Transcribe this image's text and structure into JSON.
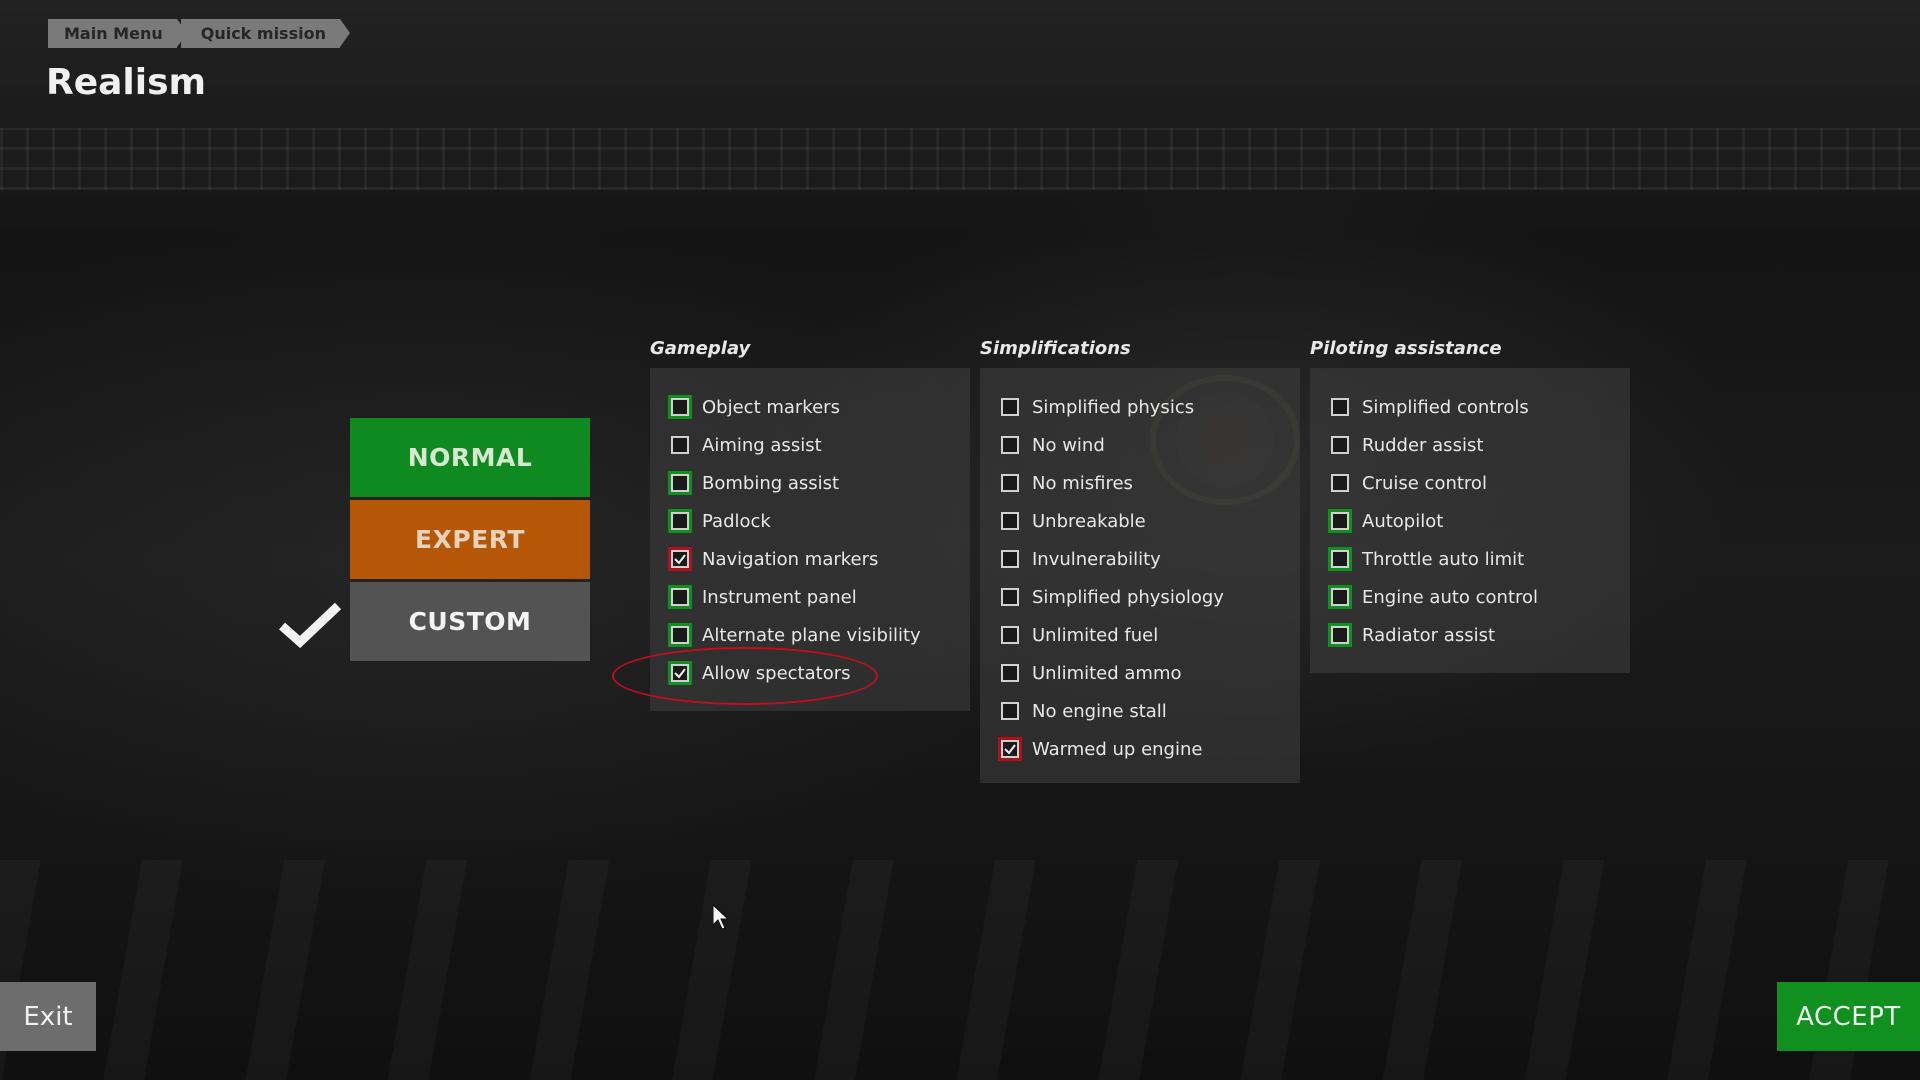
{
  "breadcrumb": [
    "Main Menu",
    "Quick mission"
  ],
  "title": "Realism",
  "presets": [
    {
      "label": "NORMAL",
      "color": "#0e8a20",
      "selected": false
    },
    {
      "label": "EXPERT",
      "color": "#b55706",
      "selected": false
    },
    {
      "label": "CUSTOM",
      "color": "#535353",
      "selected": true
    }
  ],
  "columns": [
    {
      "title": "Gameplay",
      "options": [
        {
          "label": "Object markers",
          "checked": false,
          "highlight": "green"
        },
        {
          "label": "Aiming assist",
          "checked": false,
          "highlight": "none"
        },
        {
          "label": "Bombing assist",
          "checked": false,
          "highlight": "green"
        },
        {
          "label": "Padlock",
          "checked": false,
          "highlight": "green"
        },
        {
          "label": "Navigation markers",
          "checked": true,
          "highlight": "red"
        },
        {
          "label": "Instrument panel",
          "checked": false,
          "highlight": "green"
        },
        {
          "label": "Alternate plane visibility",
          "checked": false,
          "highlight": "green"
        },
        {
          "label": "Allow spectators",
          "checked": true,
          "highlight": "green"
        }
      ]
    },
    {
      "title": "Simplifications",
      "options": [
        {
          "label": "Simplified physics",
          "checked": false,
          "highlight": "none"
        },
        {
          "label": "No wind",
          "checked": false,
          "highlight": "none"
        },
        {
          "label": "No misfires",
          "checked": false,
          "highlight": "none"
        },
        {
          "label": "Unbreakable",
          "checked": false,
          "highlight": "none"
        },
        {
          "label": "Invulnerability",
          "checked": false,
          "highlight": "none"
        },
        {
          "label": "Simplified physiology",
          "checked": false,
          "highlight": "none"
        },
        {
          "label": "Unlimited fuel",
          "checked": false,
          "highlight": "none"
        },
        {
          "label": "Unlimited ammo",
          "checked": false,
          "highlight": "none"
        },
        {
          "label": "No engine stall",
          "checked": false,
          "highlight": "none"
        },
        {
          "label": "Warmed up engine",
          "checked": true,
          "highlight": "red"
        }
      ]
    },
    {
      "title": "Piloting assistance",
      "options": [
        {
          "label": "Simplified controls",
          "checked": false,
          "highlight": "none"
        },
        {
          "label": "Rudder assist",
          "checked": false,
          "highlight": "none"
        },
        {
          "label": "Cruise control",
          "checked": false,
          "highlight": "none"
        },
        {
          "label": "Autopilot",
          "checked": false,
          "highlight": "green"
        },
        {
          "label": "Throttle auto limit",
          "checked": false,
          "highlight": "green"
        },
        {
          "label": "Engine auto control",
          "checked": false,
          "highlight": "green"
        },
        {
          "label": "Radiator assist",
          "checked": false,
          "highlight": "green"
        }
      ]
    }
  ],
  "footer": {
    "exit_label": "Exit",
    "accept_label": "ACCEPT"
  },
  "colors": {
    "green": "#10901f",
    "red": "#b0101a",
    "panel": "#3c3c3c"
  }
}
